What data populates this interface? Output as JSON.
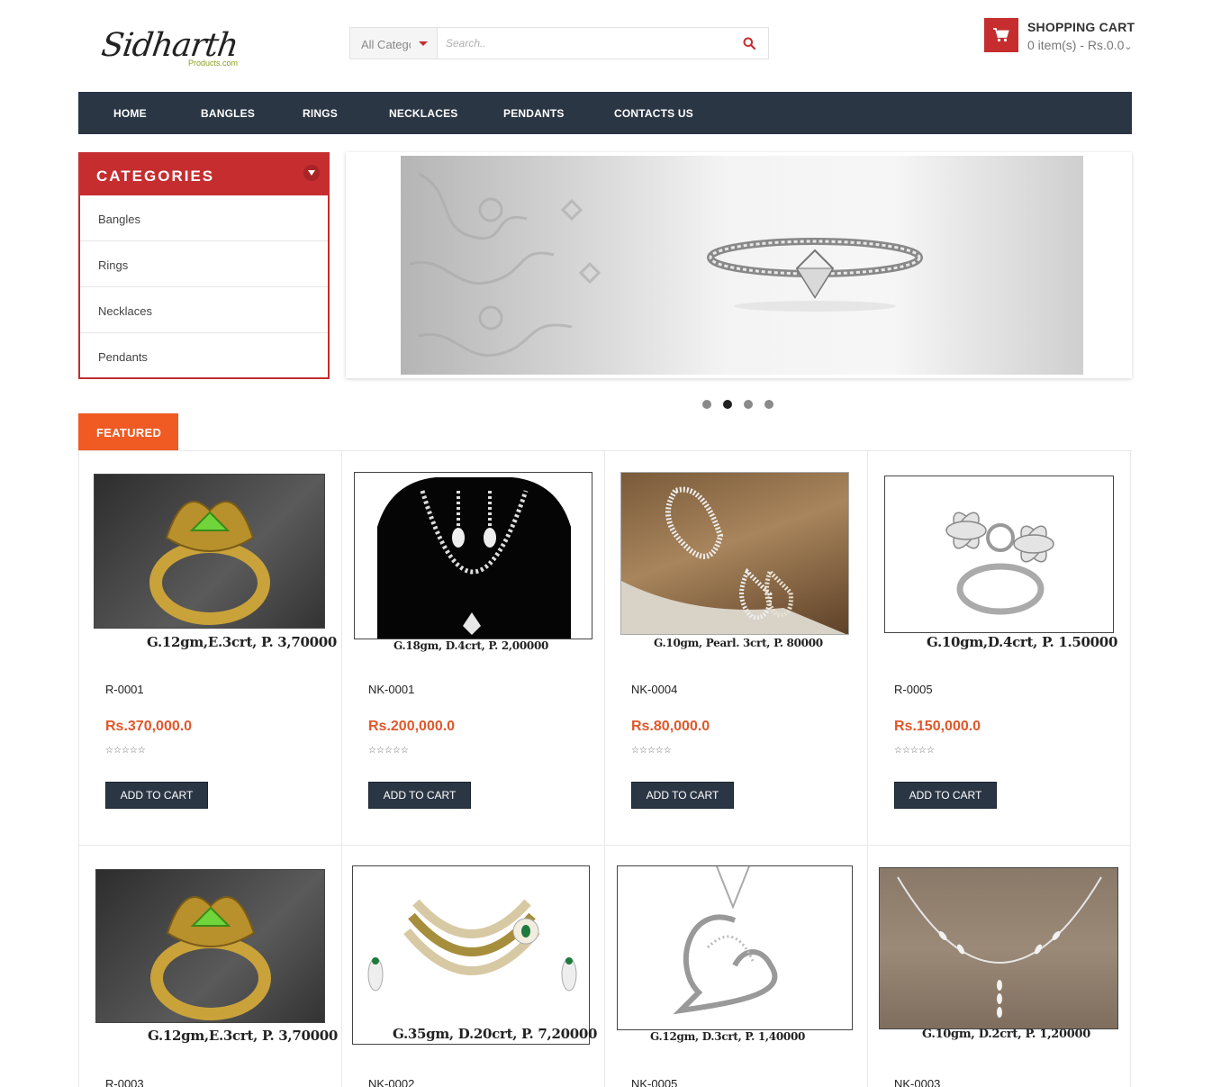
{
  "logo": {
    "main": "Sidharth",
    "sub": "Products.com"
  },
  "search": {
    "category": "All Categories",
    "placeholder": "Search.."
  },
  "cart": {
    "title": "SHOPPING CART",
    "summary": "0 item(s) - Rs.0.0"
  },
  "nav": [
    "HOME",
    "BANGLES",
    "RINGS",
    "NECKLACES",
    "PENDANTS",
    "CONTACTS US"
  ],
  "categories": {
    "title": "CATEGORIES",
    "items": [
      "Bangles",
      "Rings",
      "Necklaces",
      "Pendants"
    ]
  },
  "slider": {
    "slides": 4,
    "active_index": 1
  },
  "featured": {
    "tab": "FEATURED"
  },
  "products": [
    {
      "caption": "G.12gm,E.3crt, P. 3,70000",
      "sku": "R-0001",
      "price": "Rs.370,000.0",
      "rating": "☆☆☆☆☆",
      "button": "ADD TO CART"
    },
    {
      "caption": "G.18gm, D.4crt, P. 2,00000",
      "sku": "NK-0001",
      "price": "Rs.200,000.0",
      "rating": "☆☆☆☆☆",
      "button": "ADD TO CART"
    },
    {
      "caption": "G.10gm,  Pearl. 3crt, P. 80000",
      "sku": "NK-0004",
      "price": "Rs.80,000.0",
      "rating": "☆☆☆☆☆",
      "button": "ADD TO CART"
    },
    {
      "caption": "G.10gm,D.4crt, P. 1.50000",
      "sku": "R-0005",
      "price": "Rs.150,000.0",
      "rating": "☆☆☆☆☆",
      "button": "ADD TO CART"
    },
    {
      "caption": "G.12gm,E.3crt, P. 3,70000",
      "sku": "R-0003"
    },
    {
      "caption": "G.35gm, D.20crt, P. 7,20000",
      "sku": "NK-0002"
    },
    {
      "caption": "G.12gm, D.3crt, P. 1,40000",
      "sku": "NK-0005"
    },
    {
      "caption": "G.10gm, D.2crt, P. 1,20000",
      "sku": "NK-0003"
    }
  ],
  "colors": {
    "nav": "#2b3644",
    "accent_red": "#c52d2f",
    "featured_orange": "#f05a23",
    "price_orange": "#e0572a"
  }
}
